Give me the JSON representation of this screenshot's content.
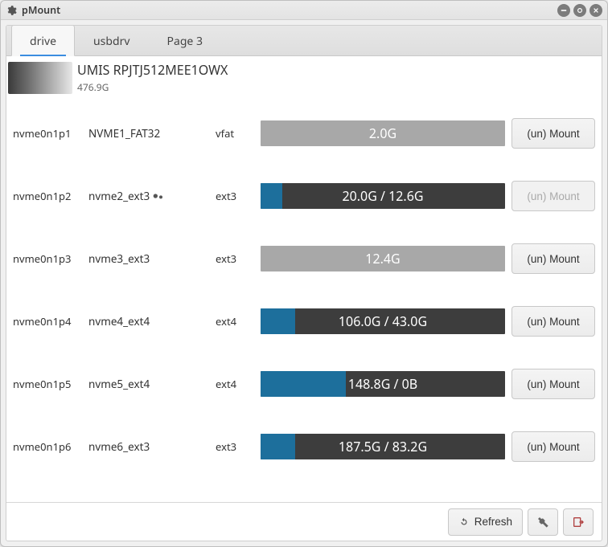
{
  "window": {
    "title": "pMount"
  },
  "tabs": [
    {
      "label": "drive",
      "active": true
    },
    {
      "label": "usbdrv",
      "active": false
    },
    {
      "label": "Page 3",
      "active": false
    }
  ],
  "drive": {
    "model": "UMIS RPJTJ512MEE1OWX",
    "size": "476.9G"
  },
  "partitions": [
    {
      "dev": "nvme0n1p1",
      "label": "NVME1_FAT32",
      "fs": "vfat",
      "mounted": false,
      "text": "2.0G",
      "fillpct": 0,
      "btn_enabled": true,
      "badge": false
    },
    {
      "dev": "nvme0n1p2",
      "label": "nvme2_ext3",
      "fs": "ext3",
      "mounted": true,
      "text": "20.0G / 12.6G",
      "fillpct": 9,
      "btn_enabled": false,
      "badge": true
    },
    {
      "dev": "nvme0n1p3",
      "label": "nvme3_ext3",
      "fs": "ext3",
      "mounted": false,
      "text": "12.4G",
      "fillpct": 0,
      "btn_enabled": true,
      "badge": false
    },
    {
      "dev": "nvme0n1p4",
      "label": "nvme4_ext4",
      "fs": "ext4",
      "mounted": true,
      "text": "106.0G / 43.0G",
      "fillpct": 14,
      "btn_enabled": true,
      "badge": false
    },
    {
      "dev": "nvme0n1p5",
      "label": "nvme5_ext4",
      "fs": "ext4",
      "mounted": true,
      "text": "148.8G / 0B",
      "fillpct": 35,
      "btn_enabled": true,
      "badge": false
    },
    {
      "dev": "nvme0n1p6",
      "label": "nvme6_ext3",
      "fs": "ext3",
      "mounted": true,
      "text": "187.5G / 83.2G",
      "fillpct": 14,
      "btn_enabled": true,
      "badge": false
    }
  ],
  "buttons": {
    "mount": "(un) Mount",
    "refresh": "Refresh"
  }
}
